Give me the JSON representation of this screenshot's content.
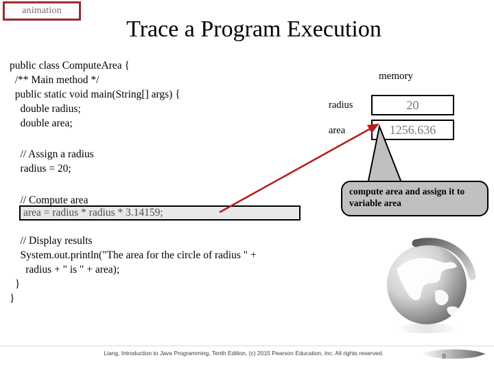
{
  "slide": {
    "badge_label": "animation",
    "title": "Trace a Program Execution"
  },
  "code": {
    "top_lines": "public class ComputeArea {\n  /** Main method */\n  public static void main(String[] args) {\n    double radius;\n    double area;",
    "mid_lines": "    // Assign a radius\n    radius = 20;",
    "comment_compute": "    // Compute area",
    "highlighted_statement": "area = radius * radius * 3.14159;",
    "bottom_lines": "    // Display results\n    System.out.println(\"The area for the circle of radius \" +\n      radius + \" is \" + area);\n  }\n}"
  },
  "memory": {
    "title": "memory",
    "rows": [
      {
        "label": "radius",
        "value": "20"
      },
      {
        "label": "area",
        "value": "1256.636"
      }
    ]
  },
  "callout": {
    "text": "compute area and assign it to variable area"
  },
  "colors": {
    "badge_border": "#9e2a2a",
    "badge_text": "#6f6f6f",
    "arrow": "#b32020",
    "highlight_bg": "#e8e8e8",
    "callout_bg": "#c0c0c0",
    "memory_value_text": "#7a7a7a"
  },
  "footer": {
    "credit": "Liang, Introduction to Java Programming, Tenth Edition, (c) 2015 Pearson Education, Inc. All rights reserved.",
    "page_number": "8"
  }
}
